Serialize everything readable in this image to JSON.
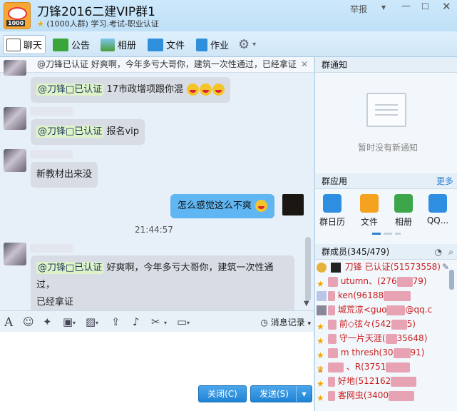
{
  "window": {
    "title": "刀锋2016二建VIP群1",
    "subtitle_count": "(1000人群)",
    "subtitle_tags": "学习.考试-职业认证",
    "report": "举报",
    "logo_text": "1000"
  },
  "toolbar": {
    "chat": "聊天",
    "announcement": "公告",
    "album": "相册",
    "files": "文件",
    "homework": "作业"
  },
  "notice_bar": "@刀锋已认证 好爽啊，今年多亏大哥你，建筑一次性通过，已经拿证",
  "messages": [
    {
      "mention": "@刀锋□已认证",
      "text": "17市政增项跟你混"
    },
    {
      "mention": "@刀锋□已认证",
      "text": "报名vip"
    },
    {
      "mention": "",
      "text": "新教材出来没"
    }
  ],
  "my_message": "怎么感觉这么不爽",
  "timestamp": "21:44:57",
  "last_message": {
    "mention": "@刀锋□已认证",
    "line1": "好爽啊，今年多亏大哥你，建筑一次性通过，",
    "line2": "已经拿证"
  },
  "input_toolbar": {
    "history": "消息记录"
  },
  "buttons": {
    "close": "关闭(C)",
    "send": "发送(S)"
  },
  "right_panel": {
    "notice_header": "群通知",
    "no_notice": "暂时没有新通知",
    "apps_header": "群应用",
    "more": "更多",
    "apps": [
      "群日历",
      "文件",
      "相册",
      "QQ..."
    ],
    "members_header": "群成员(345/479)"
  },
  "members": [
    {
      "name": "刀锋  已认证(51573558)",
      "icon": "owner-icon"
    },
    {
      "name": "utumn、(276",
      "tail": "79)",
      "icon": "star-icon"
    },
    {
      "name": "ken(96188",
      "tail": "",
      "icon": "avatar-icon"
    },
    {
      "name": "城荒凉<guo",
      "tail": "@qq.c",
      "icon": "avatar-icon"
    },
    {
      "name": "前◇弦々(542",
      "tail": "5)",
      "icon": "star-icon"
    },
    {
      "name": "守一片天涯(",
      "tail": "35648)",
      "icon": "star-icon"
    },
    {
      "name": "m thresh(30",
      "tail": "91)",
      "icon": "star-icon"
    },
    {
      "name": "、R(3751",
      "tail": "",
      "icon": "crown-icon"
    },
    {
      "name": "好地(512162",
      "tail": "",
      "icon": "star-icon"
    },
    {
      "name": "客网虫(3400",
      "tail": "",
      "icon": "star-icon"
    }
  ],
  "colors": {
    "accent": "#1f84d6",
    "bubble": "#d8dde5",
    "my_bubble": "#5fb6f2",
    "member_red": "#c81d1d"
  }
}
